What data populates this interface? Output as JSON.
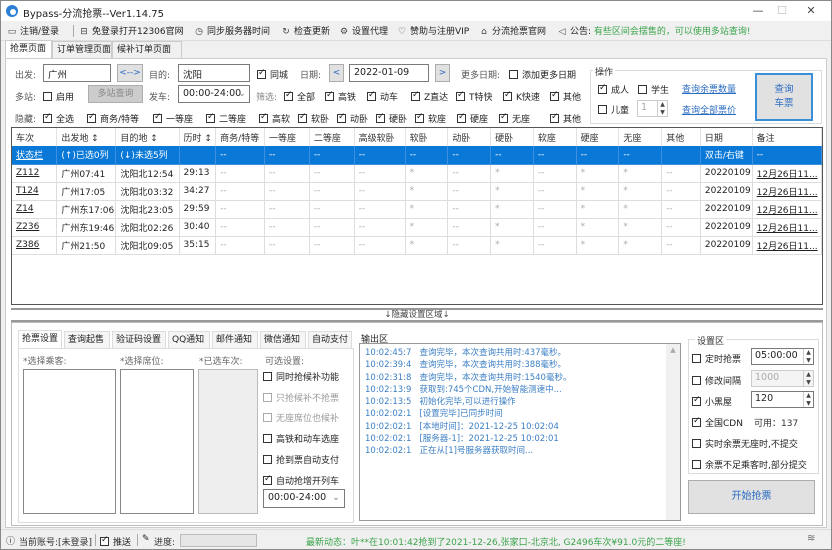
{
  "window": {
    "title": "Bypass-分流抢票--Ver1.14.75",
    "minimize": "—",
    "maximize": "☐",
    "close": "✕"
  },
  "menu": {
    "items": [
      {
        "icon": "monitor-icon",
        "glyph": "🖵",
        "label": "注销/登录"
      },
      {
        "icon": "browser-icon",
        "glyph": "⊟",
        "label": "免登录打开12306官网"
      },
      {
        "icon": "clock-icon",
        "glyph": "◷",
        "label": "同步服务器时间"
      },
      {
        "icon": "refresh-icon",
        "glyph": "↻",
        "label": "检查更新"
      },
      {
        "icon": "gear-icon",
        "glyph": "⚙",
        "label": "设置代理"
      },
      {
        "icon": "heart-icon",
        "glyph": "♡",
        "label": "赞助与注册VIP"
      },
      {
        "icon": "home-icon",
        "glyph": "⌂",
        "label": "分流抢票官网"
      },
      {
        "icon": "speaker-icon",
        "glyph": "🔈",
        "label": "公告:"
      }
    ],
    "notice": "有些区间会摆售的，可以使用多站查询!"
  },
  "main_tabs": [
    "抢票页面",
    "订单管理页面",
    "候补订单页面"
  ],
  "query": {
    "from_label": "出发:",
    "from_value": "广州",
    "swap_button": "<-->",
    "to_label": "目的:",
    "to_value": "沈阳",
    "same_city_label": "同城",
    "same_city_checked": true,
    "date_label": "日期:",
    "date_prev": "<",
    "date_value": "2022-01-09",
    "date_next": ">",
    "more_dates_label": "更多日期:",
    "add_more_dates_label": "添加更多日期",
    "add_more_dates_checked": false,
    "multi_label": "多站:",
    "multi_enable_label": "启用",
    "multi_enable_checked": false,
    "multi_query_button": "多站查询",
    "depart_label": "发车:",
    "depart_value": "00:00-24:00",
    "filter_label": "筛选:",
    "filters": [
      {
        "label": "全部",
        "checked": true
      },
      {
        "label": "高铁",
        "checked": true
      },
      {
        "label": "动车",
        "checked": true
      },
      {
        "label": "Z直达",
        "checked": true
      },
      {
        "label": "T特快",
        "checked": true
      },
      {
        "label": "K快速",
        "checked": true
      },
      {
        "label": "其他",
        "checked": true
      }
    ],
    "hide_label": "隐藏:",
    "hide_options": [
      {
        "label": "全选",
        "checked": true
      },
      {
        "label": "商务/特等",
        "checked": true
      },
      {
        "label": "一等座",
        "checked": true
      },
      {
        "label": "二等座",
        "checked": true
      },
      {
        "label": "高软",
        "checked": true
      },
      {
        "label": "软卧",
        "checked": true
      },
      {
        "label": "动卧",
        "checked": true
      },
      {
        "label": "硬卧",
        "checked": true
      },
      {
        "label": "软座",
        "checked": true
      },
      {
        "label": "硬座",
        "checked": true
      },
      {
        "label": "无座",
        "checked": true
      },
      {
        "label": "其他",
        "checked": true
      }
    ]
  },
  "operation": {
    "title": "操作",
    "adult_label": "成人",
    "adult_checked": true,
    "student_label": "学生",
    "student_checked": false,
    "child_label": "儿童",
    "child_checked": false,
    "child_count": "1",
    "query_remaining_link": "查询余票数量",
    "query_prices_link": "查询全部票价",
    "query_button_line1": "查询",
    "query_button_line2": "车票"
  },
  "table": {
    "columns": [
      "车次",
      "出发地 ↕",
      "目的地 ↕",
      "历时 ↕",
      "商务/特等",
      "一等座",
      "二等座",
      "高级软卧",
      "软卧",
      "动卧",
      "硬卧",
      "软座",
      "硬座",
      "无座",
      "其他",
      "日期",
      "备注"
    ],
    "status_row": [
      "状态栏",
      "(↑)已选0列",
      "(↓)未选5列",
      "",
      "--",
      "--",
      "--",
      "--",
      "--",
      "--",
      "--",
      "--",
      "--",
      "--",
      "",
      "双击/右键",
      "--"
    ],
    "rows": [
      [
        "Z112",
        "广州07:41",
        "沈阳北12:54",
        "29:13",
        "--",
        "--",
        "--",
        "--",
        "*",
        "--",
        "*",
        "--",
        "*",
        "*",
        "--",
        "20220109",
        "12月26日11..."
      ],
      [
        "T124",
        "广州17:05",
        "沈阳北03:32",
        "34:27",
        "--",
        "--",
        "--",
        "--",
        "*",
        "--",
        "*",
        "--",
        "*",
        "*",
        "--",
        "20220109",
        "12月26日11..."
      ],
      [
        "Z14",
        "广州东17:06",
        "沈阳北23:05",
        "29:59",
        "--",
        "--",
        "--",
        "--",
        "*",
        "--",
        "*",
        "--",
        "*",
        "*",
        "--",
        "20220109",
        "12月26日11..."
      ],
      [
        "Z236",
        "广州东19:46",
        "沈阳北02:26",
        "30:40",
        "--",
        "--",
        "--",
        "--",
        "*",
        "--",
        "*",
        "--",
        "*",
        "*",
        "--",
        "20220109",
        "12月26日11..."
      ],
      [
        "Z386",
        "广州21:50",
        "沈阳北09:05",
        "35:15",
        "--",
        "--",
        "--",
        "--",
        "*",
        "--",
        "*",
        "--",
        "*",
        "*",
        "--",
        "20220109",
        "12月26日11..."
      ]
    ]
  },
  "divider_label": "↓隐藏设置区域↓",
  "bottom_tabs": [
    "抢票设置",
    "查询起售",
    "验证码设置",
    "QQ通知",
    "邮件通知",
    "微信通知",
    "自动支付"
  ],
  "settings_panel": {
    "passengers_label": "*选择乘客:",
    "seats_label": "*选择席位:",
    "selected_trains_label": "*已选车次:",
    "optional_label": "可选设置:",
    "options": [
      {
        "label": "同时抢候补功能",
        "checked": false,
        "disabled": false
      },
      {
        "label": "只抢候补不抢票",
        "checked": false,
        "disabled": true
      },
      {
        "label": "无座席位也候补",
        "checked": false,
        "disabled": true
      },
      {
        "label": "高铁和动车选座",
        "checked": false,
        "disabled": false
      },
      {
        "label": "抢到票自动支付",
        "checked": false,
        "disabled": false
      },
      {
        "label": "自动抢增开列车",
        "checked": true,
        "disabled": false
      }
    ],
    "time_range": "00:00-24:00"
  },
  "output": {
    "title": "输出区",
    "lines": [
      {
        "time": "10:02:45:7",
        "text": "查询完毕，本次查询共用时:437毫秒。"
      },
      {
        "time": "10:02:39:4",
        "text": "查询完毕，本次查询共用时:388毫秒。"
      },
      {
        "time": "10:02:31:8",
        "text": "查询完毕，本次查询共用时:1540毫秒。"
      },
      {
        "time": "10:02:13:9",
        "text": "获取到:745个CDN,开始智能测速中..."
      },
      {
        "time": "10:02:13:5",
        "text": "初始化完毕,可以进行操作"
      },
      {
        "time": "10:02:02:1",
        "text": "[设置完毕]已同步时间"
      },
      {
        "time": "10:02:02:1",
        "text": "[本地时间]：2021-12-25 10:02:04"
      },
      {
        "time": "10:02:02:1",
        "text": "[服务器-1]：2021-12-25 10:02:01"
      },
      {
        "time": "10:02:02:1",
        "text": "正在从[1]号服务器获取时间..."
      }
    ]
  },
  "settings_area": {
    "title": "设置区",
    "timed_label": "定时抢票",
    "timed_checked": false,
    "timed_value": "05:00:00",
    "interval_label": "修改间隔",
    "interval_checked": false,
    "interval_value": "1000",
    "blackroom_label": "小黑屋",
    "blackroom_checked": true,
    "blackroom_value": "120",
    "cdn_label": "全国CDN",
    "cdn_checked": true,
    "cdn_available": "可用：137",
    "no_seat_label": "实时余票无座时,不提交",
    "no_seat_checked": false,
    "partial_label": "余票不足乘客时,部分提交",
    "partial_checked": false,
    "start_button": "开始抢票"
  },
  "statusbar": {
    "account": "当前账号:[未登录]",
    "push_label": "推送",
    "progress_label": "进度:",
    "progress": 0,
    "news": "最新动态：叶**在10:01:42抢到了2021-12-26,张家口-北京北, G2496车次¥91.0元的二等座!"
  }
}
